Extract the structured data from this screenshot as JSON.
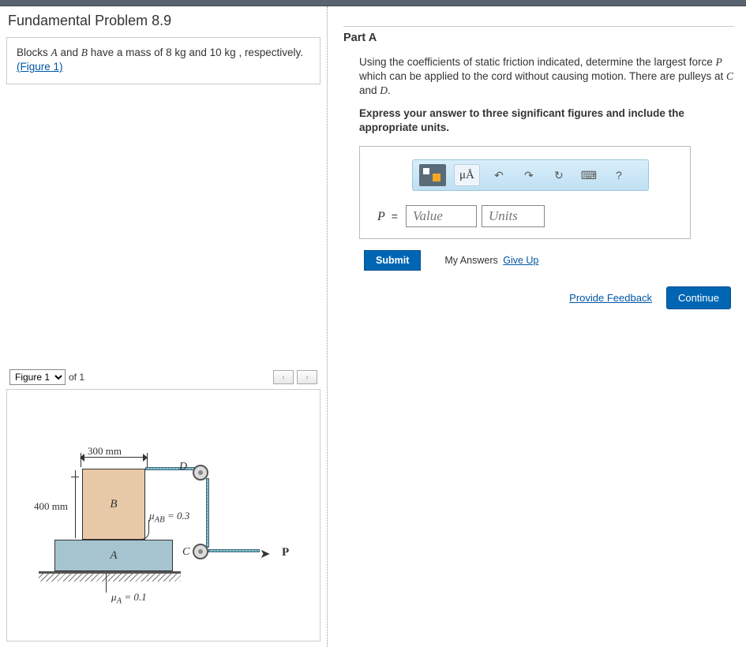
{
  "problem": {
    "title": "Fundamental Problem 8.9",
    "statement_pre": "Blocks ",
    "blockA": "A",
    "statement_mid1": " and ",
    "blockB": "B",
    "statement_mid2": " have a mass of 8 ",
    "unit1": "kg",
    "statement_mid3": " and 10 ",
    "unit2": "kg",
    "statement_mid4": " , respectively.",
    "figure_link": "(Figure 1)"
  },
  "figure_nav": {
    "selected": "Figure 1",
    "of_label": "of 1",
    "prev": "‹",
    "next": "›"
  },
  "figure": {
    "dim300": "300 mm",
    "dim400": "400 mm",
    "labelA": "A",
    "labelB": "B",
    "labelC": "C",
    "labelD": "D",
    "labelP": "P",
    "arrow": "➤",
    "muAB": "μ_AB = 0.3",
    "muA": "μ_A = 0.1"
  },
  "partA": {
    "title": "Part A",
    "text1": "Using the coefficients of static friction indicated, determine the largest force ",
    "P": "P",
    "text2": " which can be applied to the cord without causing motion. There are pulleys at ",
    "C": "C",
    "text3": " and ",
    "D": "D",
    "text4": ".",
    "instruction": "Express your answer to three significant figures and include the appropriate units."
  },
  "toolbar": {
    "mu_label": "μÅ",
    "undo": "↶",
    "redo": "↷",
    "reset": "↻",
    "keyboard": "⌨",
    "help": "?"
  },
  "answer": {
    "var": "P",
    "eq": "=",
    "value_placeholder": "Value",
    "units_placeholder": "Units"
  },
  "actions": {
    "submit": "Submit",
    "my_answers": "My Answers",
    "give_up": "Give Up",
    "provide_feedback": "Provide Feedback",
    "continue": "Continue"
  }
}
